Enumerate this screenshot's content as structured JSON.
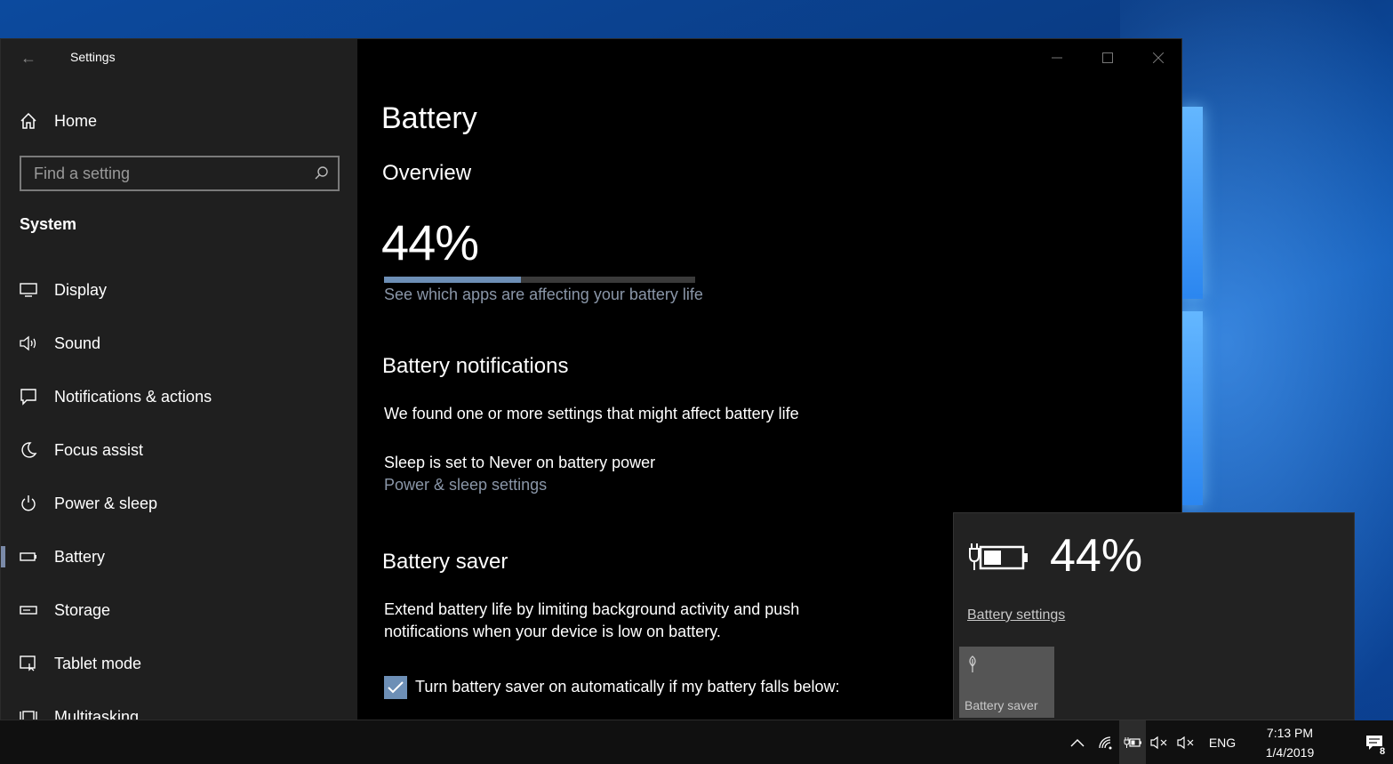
{
  "window": {
    "app_title": "Settings",
    "back_glyph": "←"
  },
  "sidebar": {
    "home_label": "Home",
    "search_placeholder": "Find a setting",
    "section_label": "System",
    "items": [
      {
        "label": "Display",
        "icon": "display-icon"
      },
      {
        "label": "Sound",
        "icon": "speaker-icon"
      },
      {
        "label": "Notifications & actions",
        "icon": "notification-icon"
      },
      {
        "label": "Focus assist",
        "icon": "moon-icon"
      },
      {
        "label": "Power & sleep",
        "icon": "power-icon"
      },
      {
        "label": "Battery",
        "icon": "battery-icon",
        "active": true
      },
      {
        "label": "Storage",
        "icon": "storage-icon"
      },
      {
        "label": "Tablet mode",
        "icon": "tablet-mode-icon"
      },
      {
        "label": "Multitasking",
        "icon": "multitasking-icon"
      }
    ]
  },
  "main": {
    "title": "Battery",
    "overview_heading": "Overview",
    "battery_percent_text": "44%",
    "battery_level": 0.44,
    "apps_link": "See which apps are affecting your battery life",
    "notifications_heading": "Battery notifications",
    "notifications_text": "We found one or more settings that might affect battery life",
    "sleep_text": "Sleep is set to Never on battery power",
    "power_link": "Power & sleep settings",
    "saver_heading": "Battery saver",
    "saver_desc_line1": "Extend battery life by limiting background activity and push",
    "saver_desc_line2": "notifications when your device is low on battery.",
    "saver_checkbox_label": "Turn battery saver on automatically if my battery falls below:",
    "saver_checkbox_checked": true
  },
  "flyout": {
    "percent_text": "44%",
    "settings_link": "Battery settings",
    "saver_tile_label": "Battery saver"
  },
  "taskbar": {
    "language": "ENG",
    "time": "7:13 PM",
    "date": "1/4/2019",
    "notification_count": "8"
  },
  "colors": {
    "accent": "#6d8fb6",
    "sidebar_bg": "#1f1f1f",
    "content_bg": "#000000",
    "link": "#8a96a8"
  }
}
